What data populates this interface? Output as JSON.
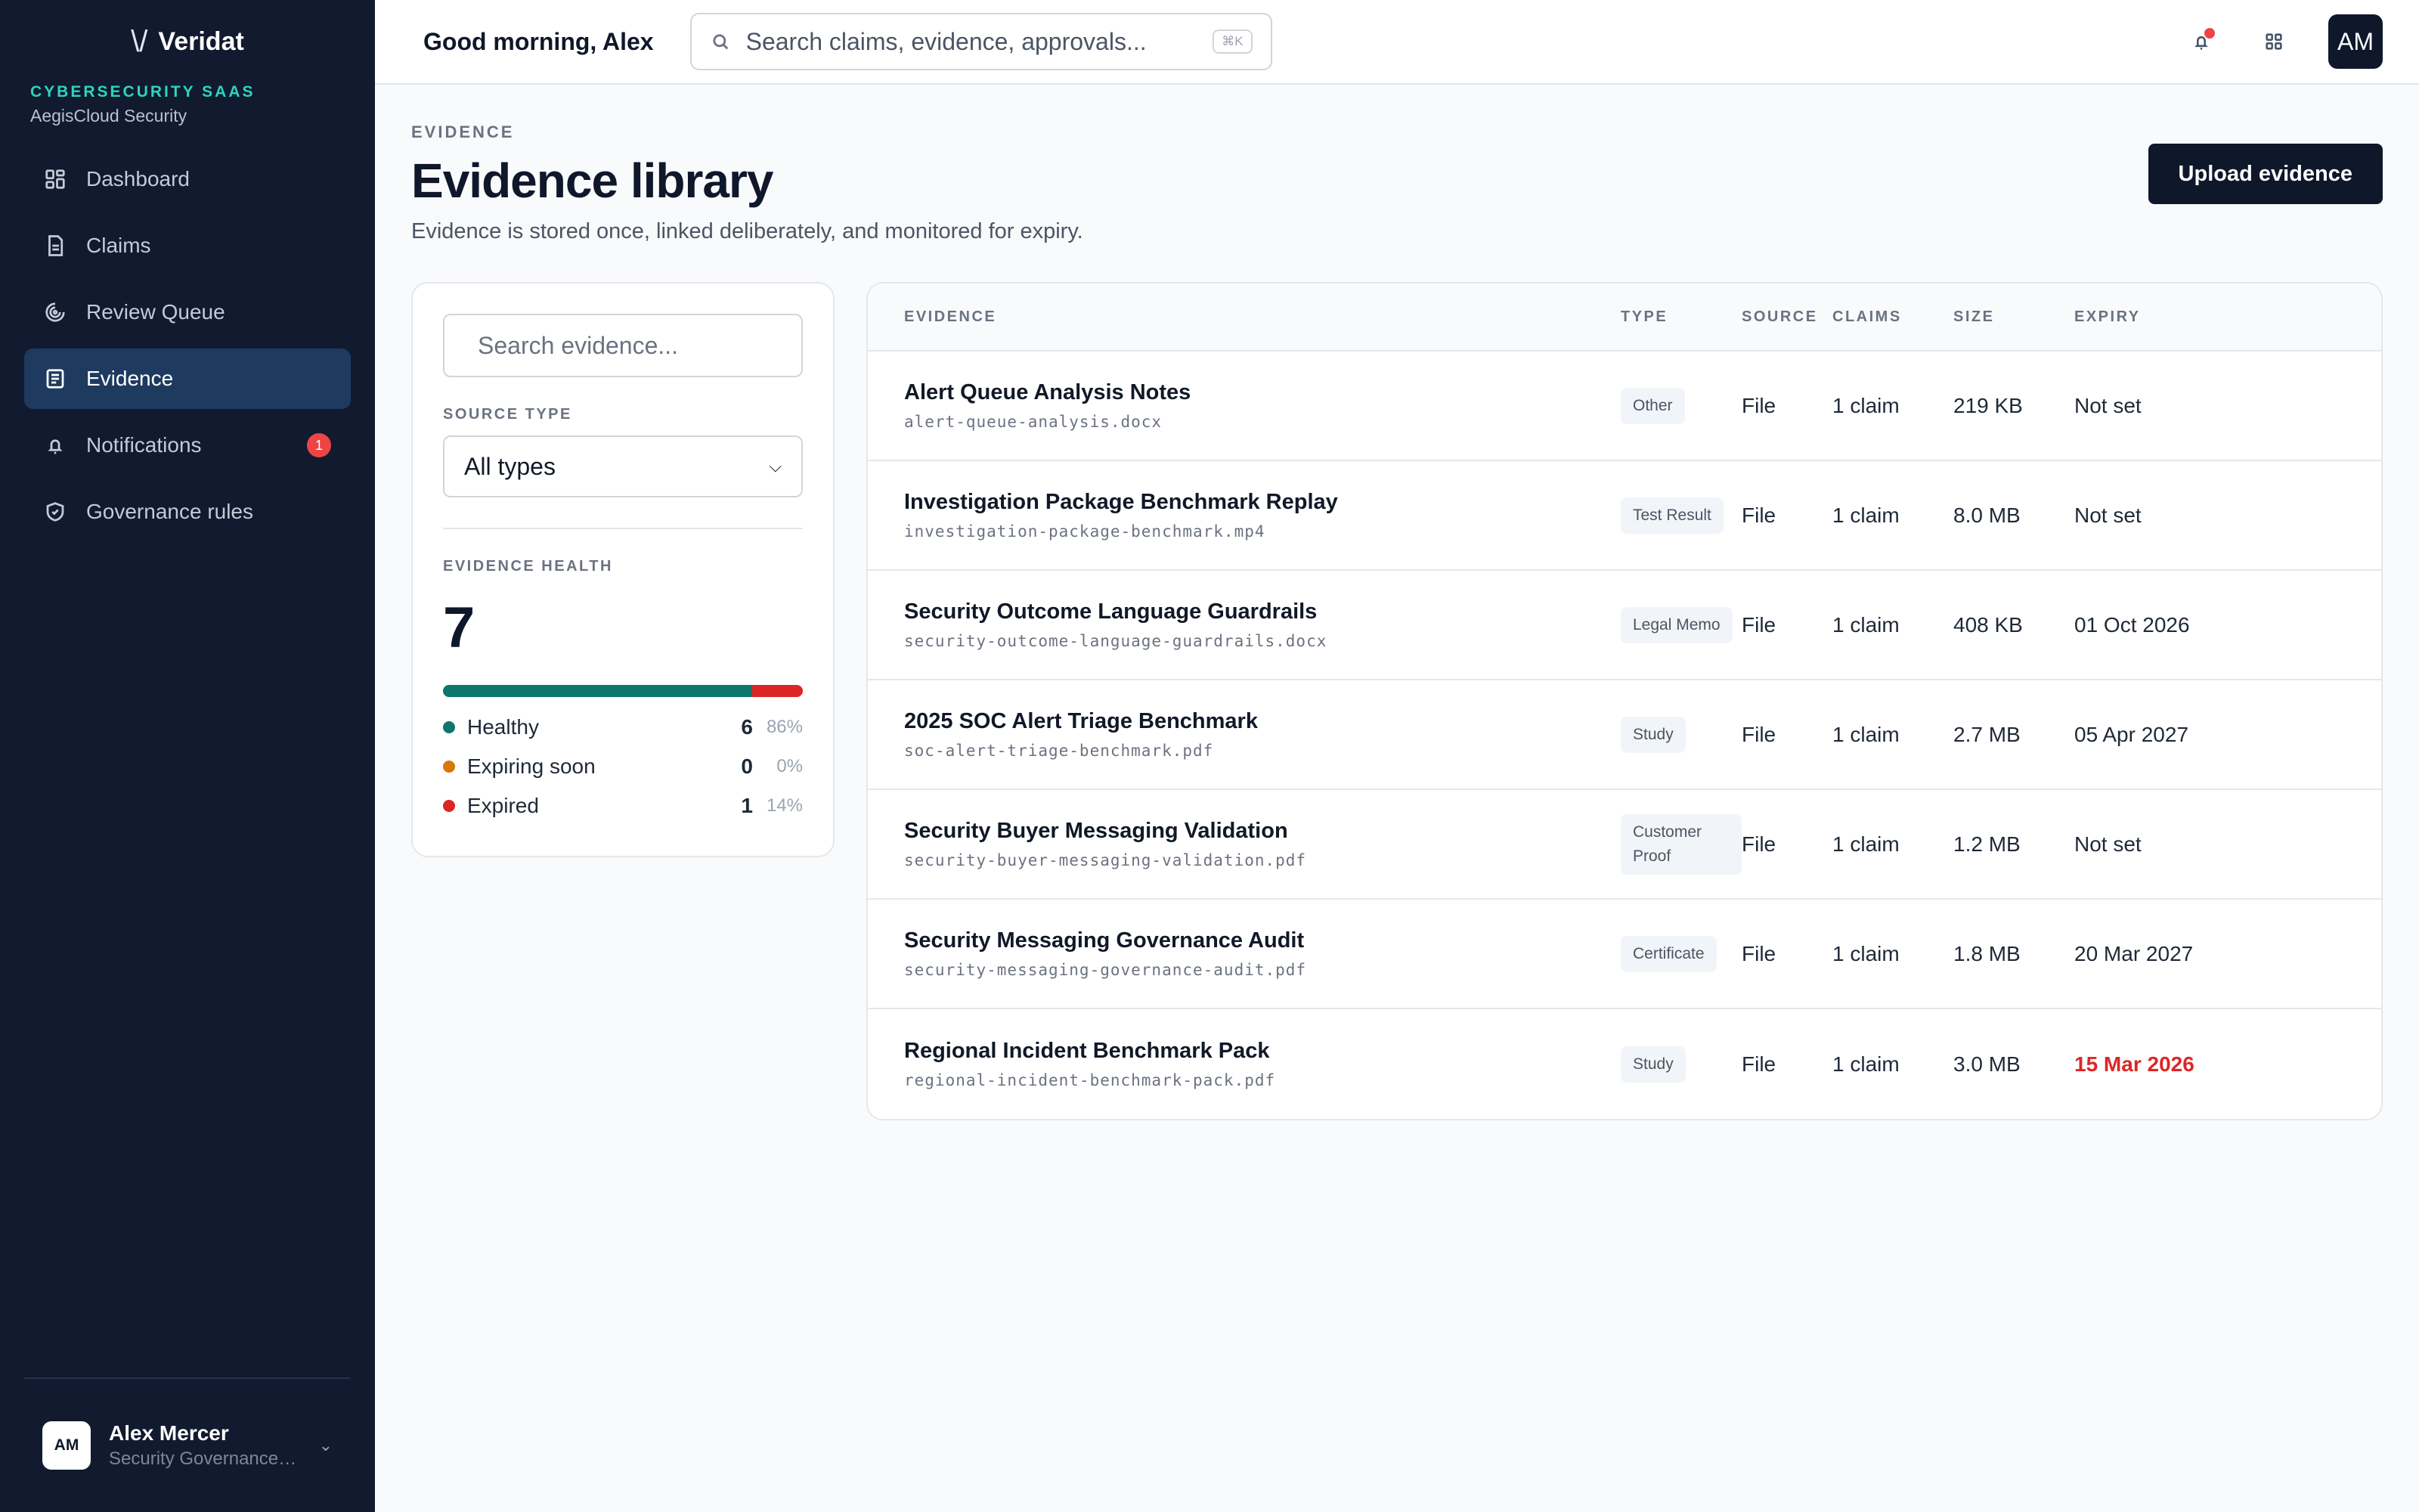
{
  "brand": {
    "name": "Veridat",
    "mark": "\\/"
  },
  "org": {
    "tag": "CYBERSECURITY SAAS",
    "name": "AegisCloud Security"
  },
  "nav": [
    {
      "label": "Dashboard",
      "icon": "dashboard-icon",
      "active": false
    },
    {
      "label": "Claims",
      "icon": "document-icon",
      "active": false
    },
    {
      "label": "Review Queue",
      "icon": "review-icon",
      "active": false
    },
    {
      "label": "Evidence",
      "icon": "evidence-icon",
      "active": true
    },
    {
      "label": "Notifications",
      "icon": "bell-icon",
      "active": false,
      "badge": "1"
    },
    {
      "label": "Governance rules",
      "icon": "shield-icon",
      "active": false
    }
  ],
  "user": {
    "initials": "AM",
    "name": "Alex Mercer",
    "role": "Security Governance Lead"
  },
  "topbar": {
    "greeting": "Good morning, Alex",
    "search_placeholder": "Search claims, evidence, approvals...",
    "shortcut": "⌘K",
    "avatar_initials": "AM"
  },
  "page": {
    "eyebrow": "EVIDENCE",
    "title": "Evidence library",
    "subtitle": "Evidence is stored once, linked deliberately, and monitored for expiry.",
    "upload_label": "Upload evidence"
  },
  "filters": {
    "search_placeholder": "Search evidence...",
    "source_type_label": "SOURCE TYPE",
    "source_type_value": "All types"
  },
  "health": {
    "label": "EVIDENCE HEALTH",
    "total": "7",
    "items": [
      {
        "name": "Healthy",
        "count": "6",
        "pct": "86%",
        "fraction": 0.86,
        "color": "#0f766e"
      },
      {
        "name": "Expiring soon",
        "count": "0",
        "pct": "0%",
        "fraction": 0.0,
        "color": "#d97706"
      },
      {
        "name": "Expired",
        "count": "1",
        "pct": "14%",
        "fraction": 0.14,
        "color": "#dc2626"
      }
    ]
  },
  "table": {
    "headers": [
      "EVIDENCE",
      "TYPE",
      "SOURCE",
      "CLAIMS",
      "SIZE",
      "EXPIRY"
    ],
    "rows": [
      {
        "title": "Alert Queue Analysis Notes",
        "file": "alert-queue-analysis.docx",
        "type": "Other",
        "source": "File",
        "claims": "1 claim",
        "size": "219 KB",
        "expiry": "Not set",
        "expired": false
      },
      {
        "title": "Investigation Package Benchmark Replay",
        "file": "investigation-package-benchmark.mp4",
        "type": "Test Result",
        "source": "File",
        "claims": "1 claim",
        "size": "8.0 MB",
        "expiry": "Not set",
        "expired": false
      },
      {
        "title": "Security Outcome Language Guardrails",
        "file": "security-outcome-language-guardrails.docx",
        "type": "Legal Memo",
        "source": "File",
        "claims": "1 claim",
        "size": "408 KB",
        "expiry": "01 Oct 2026",
        "expired": false
      },
      {
        "title": "2025 SOC Alert Triage Benchmark",
        "file": "soc-alert-triage-benchmark.pdf",
        "type": "Study",
        "source": "File",
        "claims": "1 claim",
        "size": "2.7 MB",
        "expiry": "05 Apr 2027",
        "expired": false
      },
      {
        "title": "Security Buyer Messaging Validation",
        "file": "security-buyer-messaging-validation.pdf",
        "type": "Customer Proof",
        "source": "File",
        "claims": "1 claim",
        "size": "1.2 MB",
        "expiry": "Not set",
        "expired": false
      },
      {
        "title": "Security Messaging Governance Audit",
        "file": "security-messaging-governance-audit.pdf",
        "type": "Certificate",
        "source": "File",
        "claims": "1 claim",
        "size": "1.8 MB",
        "expiry": "20 Mar 2027",
        "expired": false
      },
      {
        "title": "Regional Incident Benchmark Pack",
        "file": "regional-incident-benchmark-pack.pdf",
        "type": "Study",
        "source": "File",
        "claims": "1 claim",
        "size": "3.0 MB",
        "expiry": "15 Mar 2026",
        "expired": true
      }
    ]
  }
}
